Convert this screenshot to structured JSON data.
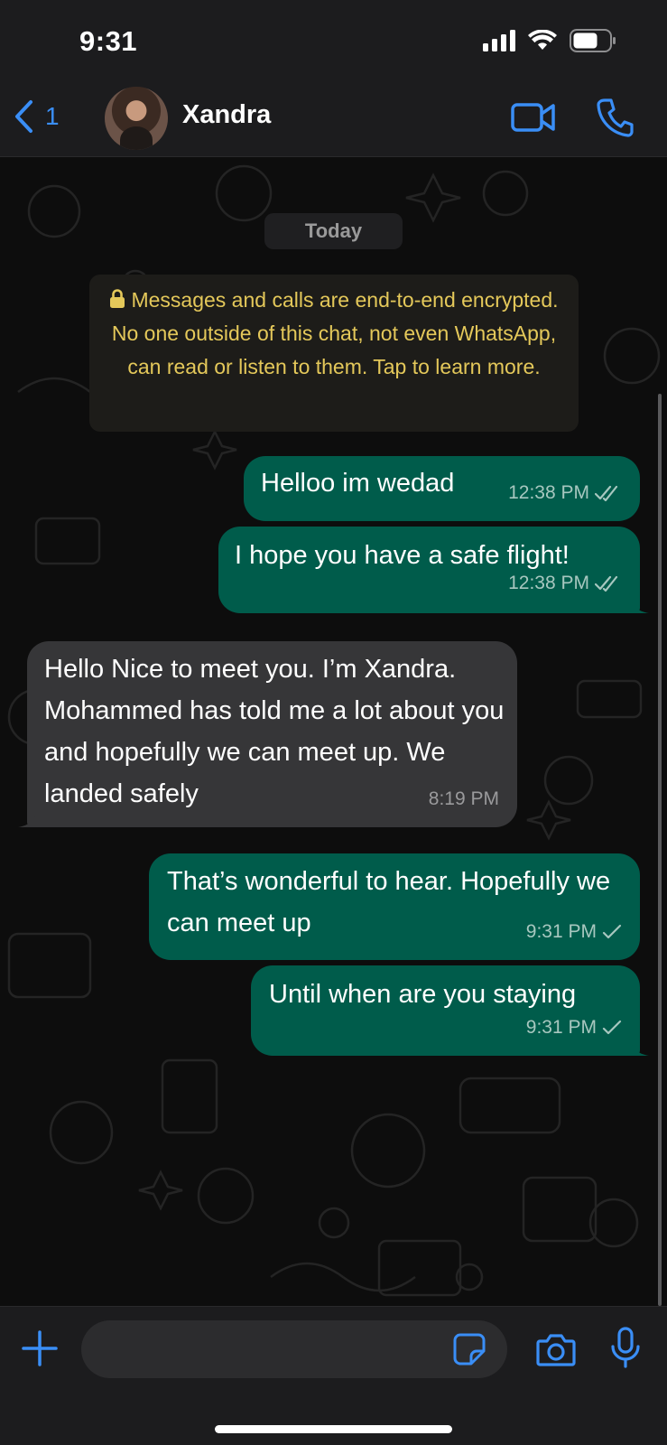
{
  "status_bar": {
    "time": "9:31"
  },
  "nav": {
    "back_count": "1",
    "contact_name": "Xandra"
  },
  "chat": {
    "date_label": "Today",
    "encryption_notice": "Messages and calls are end-to-end encrypted. No one outside of this chat, not even WhatsApp, can read or listen to them. Tap to learn more.",
    "messages": [
      {
        "direction": "outgoing",
        "text": "Helloo im wedad",
        "time": "12:38 PM",
        "status": "read"
      },
      {
        "direction": "outgoing",
        "text": "I hope you have a safe flight!",
        "time": "12:38 PM",
        "status": "read"
      },
      {
        "direction": "incoming",
        "text": "Hello Nice to meet you. I’m Xandra. Mohammed has told me a lot about you and hopefully we can meet up. We landed safely",
        "time": "8:19 PM"
      },
      {
        "direction": "outgoing",
        "text": "That’s wonderful to hear. Hopefully we can meet up",
        "time": "9:31 PM",
        "status": "sent"
      },
      {
        "direction": "outgoing",
        "text": "Until when are you staying",
        "time": "9:31 PM",
        "status": "sent"
      }
    ]
  },
  "composer": {
    "message_value": ""
  },
  "colors": {
    "accent": "#3a8ef6",
    "outgoing_bubble": "#005c4b",
    "incoming_bubble": "#363638",
    "encryption_text": "#e4c85a"
  },
  "icons": {
    "back": "chevron-left-icon",
    "video": "video-camera-icon",
    "call": "phone-icon",
    "plus": "plus-icon",
    "sticker": "sticker-icon",
    "camera": "camera-icon",
    "mic": "microphone-icon",
    "read": "double-check-icon",
    "sent": "single-check-icon",
    "lock": "lock-icon"
  }
}
